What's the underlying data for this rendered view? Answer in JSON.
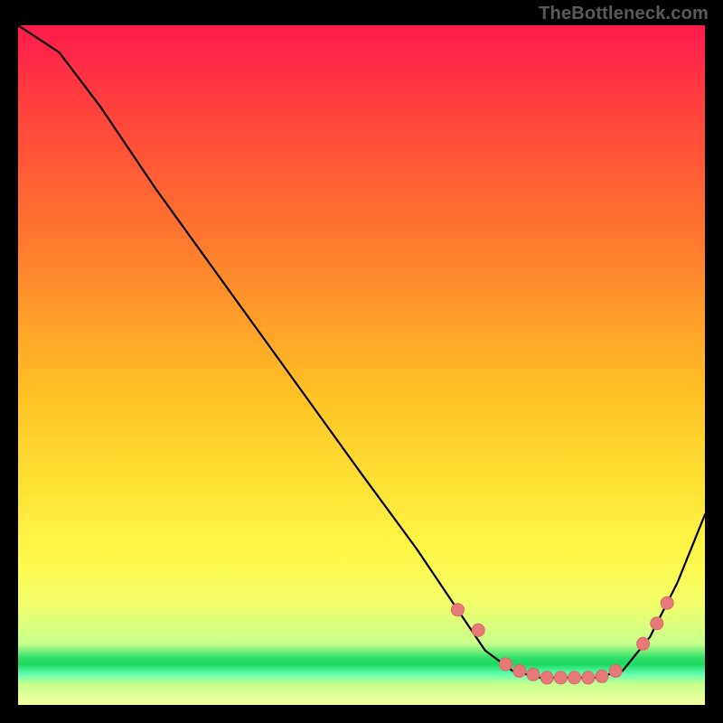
{
  "attribution": "TheBottleneck.com",
  "colors": {
    "gradient_top": "#ff1a4d",
    "gradient_mid_orange": "#ff7a2e",
    "gradient_mid_yellow": "#ffe236",
    "gradient_green_band": "#1bd95f",
    "marker_fill": "#e77a79",
    "marker_stroke": "#d76766",
    "curve": "#000000",
    "frame": "#000000"
  },
  "chart_data": {
    "type": "line",
    "title": "",
    "xlabel": "",
    "ylabel": "",
    "x_range": [
      0,
      100
    ],
    "y_range": [
      0,
      100
    ],
    "grid": false,
    "legend": false,
    "series": [
      {
        "name": "curve",
        "comment": "y read as vertical position (0 at bottom, 100 at top). Steep descending left segment, flat trough near bottom around x≈70–88, then rise to right edge.",
        "points": [
          {
            "x": 0,
            "y": 100
          },
          {
            "x": 6,
            "y": 96
          },
          {
            "x": 12,
            "y": 88
          },
          {
            "x": 20,
            "y": 76
          },
          {
            "x": 30,
            "y": 62
          },
          {
            "x": 40,
            "y": 48
          },
          {
            "x": 50,
            "y": 34
          },
          {
            "x": 58,
            "y": 23
          },
          {
            "x": 64,
            "y": 14
          },
          {
            "x": 68,
            "y": 8
          },
          {
            "x": 72,
            "y": 5
          },
          {
            "x": 76,
            "y": 4
          },
          {
            "x": 80,
            "y": 4
          },
          {
            "x": 84,
            "y": 4
          },
          {
            "x": 88,
            "y": 5
          },
          {
            "x": 92,
            "y": 10
          },
          {
            "x": 96,
            "y": 18
          },
          {
            "x": 100,
            "y": 28
          }
        ]
      }
    ],
    "markers": {
      "name": "trough-markers",
      "comment": "Pink dotted markers along the trough and ascending segment.",
      "points": [
        {
          "x": 64,
          "y": 14
        },
        {
          "x": 67,
          "y": 11
        },
        {
          "x": 71,
          "y": 6
        },
        {
          "x": 73,
          "y": 5
        },
        {
          "x": 75,
          "y": 4.5
        },
        {
          "x": 77,
          "y": 4
        },
        {
          "x": 79,
          "y": 4
        },
        {
          "x": 81,
          "y": 4
        },
        {
          "x": 83,
          "y": 4
        },
        {
          "x": 85,
          "y": 4.2
        },
        {
          "x": 87,
          "y": 5
        },
        {
          "x": 91,
          "y": 9
        },
        {
          "x": 93,
          "y": 12
        },
        {
          "x": 94.5,
          "y": 15
        }
      ]
    }
  }
}
